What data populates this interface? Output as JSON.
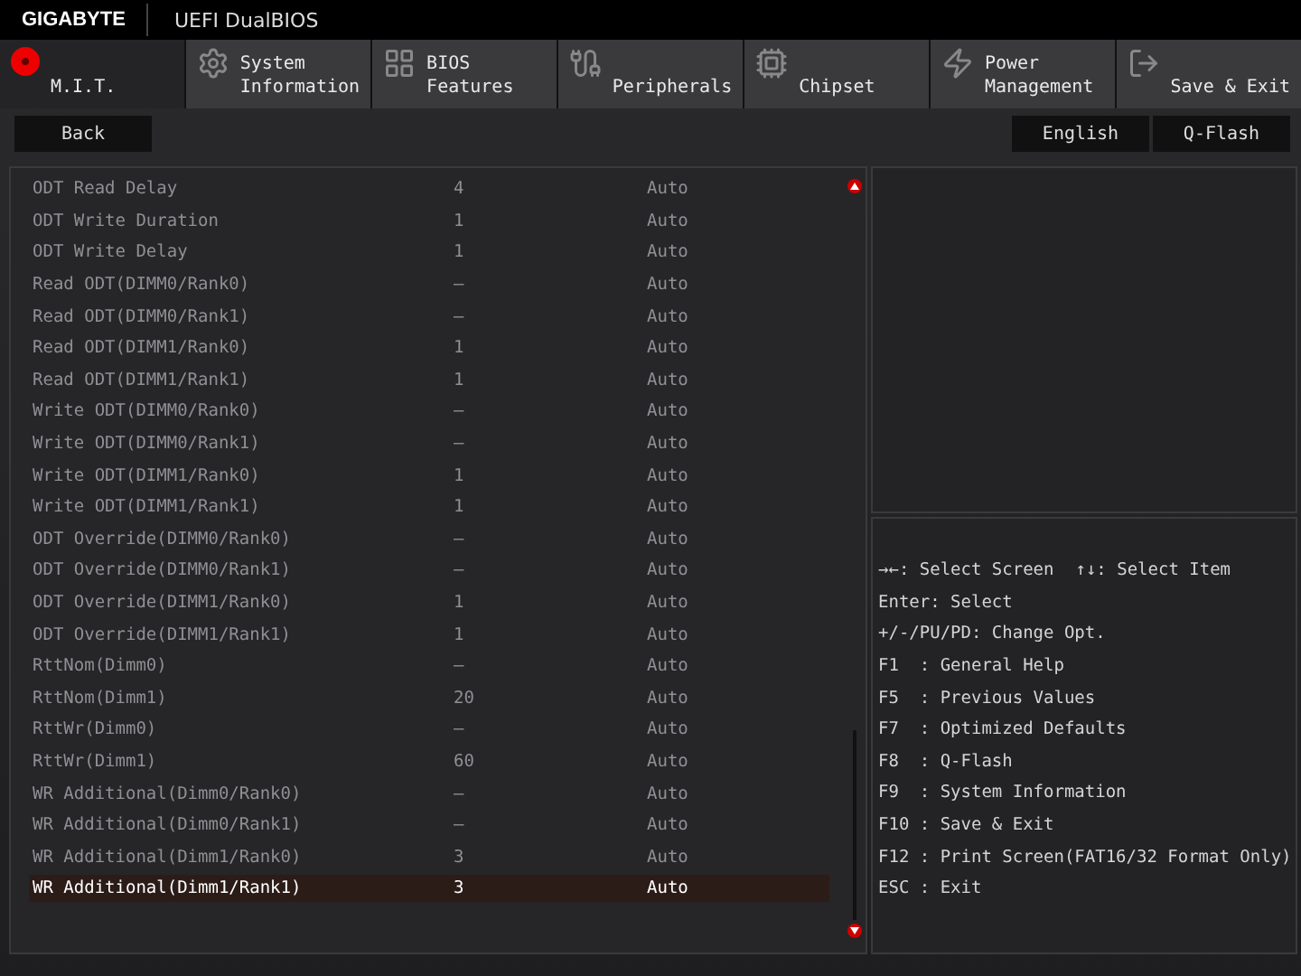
{
  "header": {
    "brand": "GIGABYTE",
    "title": "UEFI DualBIOS"
  },
  "tabs": [
    {
      "lines": [
        "M.I.T."
      ],
      "selected": true
    },
    {
      "lines": [
        "System",
        "Information"
      ],
      "selected": false
    },
    {
      "lines": [
        "BIOS",
        "Features"
      ],
      "selected": false
    },
    {
      "lines": [
        "Peripherals"
      ],
      "selected": false
    },
    {
      "lines": [
        "Chipset"
      ],
      "selected": false
    },
    {
      "lines": [
        "Power",
        "Management"
      ],
      "selected": false
    },
    {
      "lines": [
        "Save & Exit"
      ],
      "selected": false
    }
  ],
  "toolbar": {
    "left": [
      "Back"
    ],
    "right": [
      "English",
      "Q-Flash"
    ]
  },
  "rows": [
    {
      "label": "ODT Read Delay",
      "value": "4",
      "option": "Auto",
      "selected": false
    },
    {
      "label": "ODT Write Duration",
      "value": "1",
      "option": "Auto",
      "selected": false
    },
    {
      "label": "ODT Write Delay",
      "value": "1",
      "option": "Auto",
      "selected": false
    },
    {
      "label": "Read ODT(DIMM0/Rank0)",
      "value": "–",
      "option": "Auto",
      "selected": false
    },
    {
      "label": "Read ODT(DIMM0/Rank1)",
      "value": "–",
      "option": "Auto",
      "selected": false
    },
    {
      "label": "Read ODT(DIMM1/Rank0)",
      "value": "1",
      "option": "Auto",
      "selected": false
    },
    {
      "label": "Read ODT(DIMM1/Rank1)",
      "value": "1",
      "option": "Auto",
      "selected": false
    },
    {
      "label": "Write ODT(DIMM0/Rank0)",
      "value": "–",
      "option": "Auto",
      "selected": false
    },
    {
      "label": "Write ODT(DIMM0/Rank1)",
      "value": "–",
      "option": "Auto",
      "selected": false
    },
    {
      "label": "Write ODT(DIMM1/Rank0)",
      "value": "1",
      "option": "Auto",
      "selected": false
    },
    {
      "label": "Write ODT(DIMM1/Rank1)",
      "value": "1",
      "option": "Auto",
      "selected": false
    },
    {
      "label": "ODT Override(DIMM0/Rank0)",
      "value": "–",
      "option": "Auto",
      "selected": false
    },
    {
      "label": "ODT Override(DIMM0/Rank1)",
      "value": "–",
      "option": "Auto",
      "selected": false
    },
    {
      "label": "ODT Override(DIMM1/Rank0)",
      "value": "1",
      "option": "Auto",
      "selected": false
    },
    {
      "label": "ODT Override(DIMM1/Rank1)",
      "value": "1",
      "option": "Auto",
      "selected": false
    },
    {
      "label": "RttNom(Dimm0)",
      "value": "–",
      "option": "Auto",
      "selected": false
    },
    {
      "label": "RttNom(Dimm1)",
      "value": "20",
      "option": "Auto",
      "selected": false
    },
    {
      "label": "RttWr(Dimm0)",
      "value": "–",
      "option": "Auto",
      "selected": false
    },
    {
      "label": "RttWr(Dimm1)",
      "value": "60",
      "option": "Auto",
      "selected": false
    },
    {
      "label": "WR Additional(Dimm0/Rank0)",
      "value": "–",
      "option": "Auto",
      "selected": false
    },
    {
      "label": "WR Additional(Dimm0/Rank1)",
      "value": "–",
      "option": "Auto",
      "selected": false
    },
    {
      "label": "WR Additional(Dimm1/Rank0)",
      "value": "3",
      "option": "Auto",
      "selected": false
    },
    {
      "label": "WR Additional(Dimm1/Rank1)",
      "value": "3",
      "option": "Auto",
      "selected": true
    }
  ],
  "help_top": [
    "→←: Select Screen",
    "↑↓: Select Item"
  ],
  "help": [
    "Enter: Select",
    "+/-/PU/PD: Change Opt.",
    "F1  : General Help",
    "F5  : Previous Values",
    "F7  : Optimized Defaults",
    "F8  : Q-Flash",
    "F9  : System Information",
    "F10 : Save & Exit",
    "F12 : Print Screen(FAT16/32 Format Only)",
    "ESC : Exit"
  ]
}
